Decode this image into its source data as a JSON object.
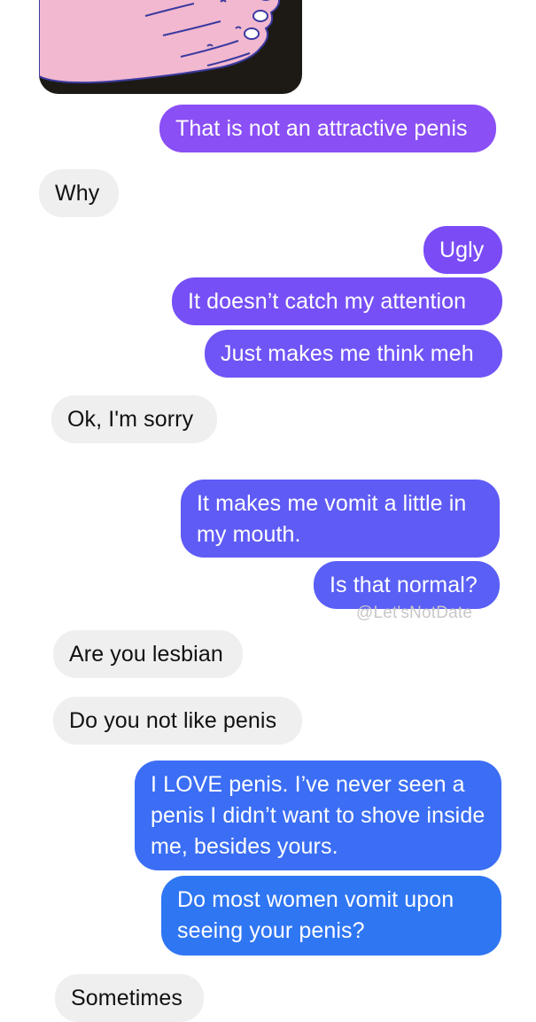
{
  "thread": {
    "attachment": {
      "icon": "hand-illustration",
      "background": "#1d1a16",
      "skin": "#f2b8cf"
    },
    "messages": [
      {
        "from": "me",
        "text": "That is not an attractive penis",
        "color": "#8a4ff5"
      },
      {
        "from": "them",
        "text": "Why"
      },
      {
        "from": "me",
        "text": "Ugly",
        "color": "#7b4cf6"
      },
      {
        "from": "me",
        "text": "It doesn’t catch my attention",
        "color": "#7650f6"
      },
      {
        "from": "me",
        "text": "Just makes me think meh",
        "color": "#6f55f6"
      },
      {
        "from": "them",
        "text": "Ok, I'm sorry"
      },
      {
        "from": "me",
        "text": "It makes me vomit a little in my mouth.",
        "color": "#5f5bf5"
      },
      {
        "from": "me",
        "text": "Is that normal?",
        "color": "#5a5ff5"
      },
      {
        "from": "them",
        "text": "Are you lesbian"
      },
      {
        "from": "them",
        "text": "Do you not like penis"
      },
      {
        "from": "me",
        "text": "I LOVE penis. I’ve never seen a penis I didn’t want to shove inside me, besides yours.",
        "color": "#3b6ef4"
      },
      {
        "from": "me",
        "text": "Do most women vomit upon seeing your penis?",
        "color": "#2f76f3"
      },
      {
        "from": "them",
        "text": "Sometimes"
      }
    ]
  },
  "watermark": "@Let'sNotDate"
}
